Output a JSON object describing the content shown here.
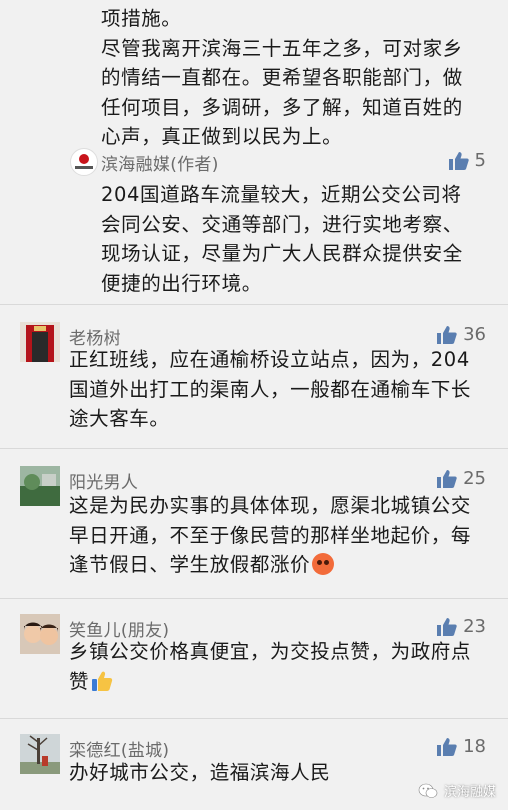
{
  "top_reply": {
    "lines": [
      "项措施。",
      "尽管我离开滨海三十五年之多，可对家乡",
      "的情结一直都在。更希望各职能部门，做",
      "任何项目，多调研，多了解，知道百姓的",
      "心声，真正做到以民为上。"
    ]
  },
  "author_reply": {
    "name": "滨海融媒(作者)",
    "avatar_text": "滨海融媒",
    "likes": "5",
    "lines": [
      "204国道路车流量较大，近期公交公司将",
      "会同公安、交通等部门，进行实地考察、",
      "现场认证，尽量为广大人民群众提供安全",
      "便捷的出行环境。"
    ]
  },
  "comments": [
    {
      "name": "老杨树",
      "likes": "36",
      "lines": [
        "正红班线，应在通榆桥设立站点，因为，204",
        "国道外出打工的渠南人，一般都在通榆车下长",
        "途大客车。"
      ]
    },
    {
      "name": "阳光男人",
      "likes": "25",
      "lines": [
        "这是为民办实事的具体体现，愿渠北城镇公交",
        "早日开通，不至于像民营的那样坐地起价，每",
        "逢节假日、学生放假都涨价"
      ],
      "emoji": "angry-face"
    },
    {
      "name": "笑鱼儿(朋友)",
      "likes": "23",
      "lines": [
        "乡镇公交价格真便宜，为交投点赞，为政府点",
        "赞"
      ],
      "emoji": "thumbs-up"
    },
    {
      "name": "栾德红(盐城)",
      "likes": "18",
      "lines": [
        "办好城市公交，造福滨海人民"
      ]
    }
  ],
  "watermark": "滨海融媒",
  "colors": {
    "background": "#f1f1f1",
    "like_icon": "#5a7eb0",
    "name_text": "#6b6b6b",
    "body_text": "#1a1a1a",
    "author_avatar_red": "#c8141b"
  }
}
